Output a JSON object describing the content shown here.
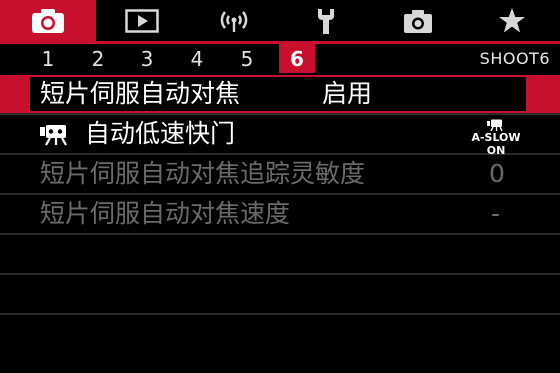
{
  "tabs": [
    {
      "icon": "camera-icon",
      "active": true
    },
    {
      "icon": "playback-icon",
      "active": false
    },
    {
      "icon": "wireless-icon",
      "active": false
    },
    {
      "icon": "wrench-icon",
      "active": false
    },
    {
      "icon": "custom-camera-icon",
      "active": false
    },
    {
      "icon": "star-icon",
      "active": false
    }
  ],
  "pages": {
    "numbers": [
      "1",
      "2",
      "3",
      "4",
      "5",
      "6"
    ],
    "active_index": 5,
    "label": "SHOOT6"
  },
  "menu": {
    "items": [
      {
        "label": "短片伺服自动对焦",
        "value": "启用",
        "state": "selected"
      },
      {
        "label": "自动低速快门",
        "value": "A-SLOW ON",
        "state": "normal"
      },
      {
        "label": "短片伺服自动对焦追踪灵敏度",
        "value": "0",
        "state": "disabled"
      },
      {
        "label": "短片伺服自动对焦速度",
        "value": "-",
        "state": "disabled"
      }
    ]
  },
  "colors": {
    "accent": "#c8102e",
    "disabled": "#6a6a6a",
    "background": "#000000"
  }
}
